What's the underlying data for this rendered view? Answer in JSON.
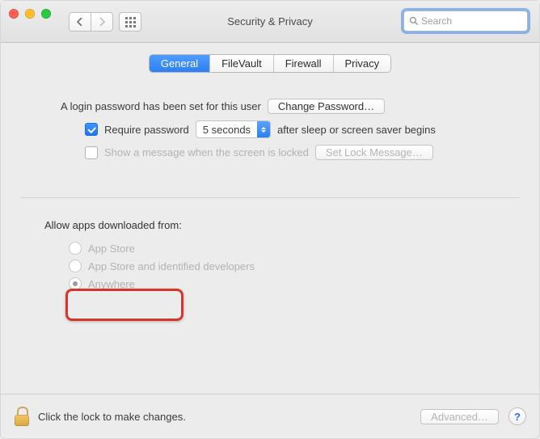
{
  "window": {
    "title": "Security & Privacy"
  },
  "search": {
    "placeholder": "Search"
  },
  "tabs": {
    "general": "General",
    "filevault": "FileVault",
    "firewall": "Firewall",
    "privacy": "Privacy"
  },
  "login": {
    "text": "A login password has been set for this user",
    "change_pw_btn": "Change Password…",
    "require_pw_label": "Require password",
    "require_pw_delay": "5 seconds",
    "after_text": "after sleep or screen saver begins",
    "show_msg_label": "Show a message when the screen is locked",
    "set_lock_msg_btn": "Set Lock Message…"
  },
  "download": {
    "title": "Allow apps downloaded from:",
    "opt_appstore": "App Store",
    "opt_identified": "App Store and identified developers",
    "opt_anywhere": "Anywhere"
  },
  "footer": {
    "lock_text": "Click the lock to make changes.",
    "advanced_btn": "Advanced…",
    "help": "?"
  }
}
